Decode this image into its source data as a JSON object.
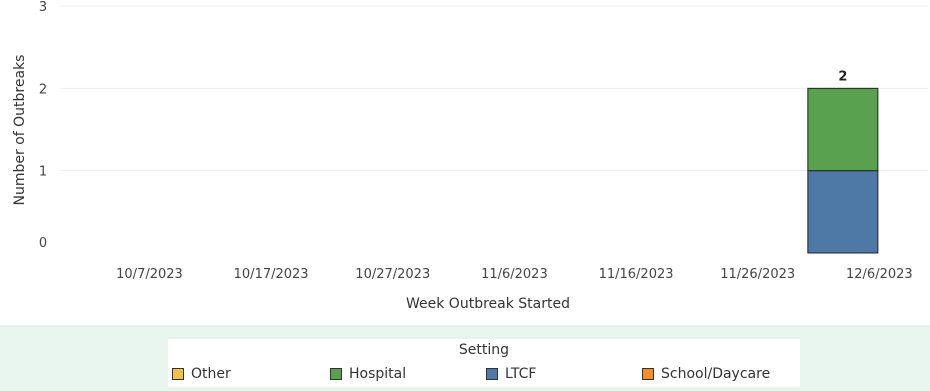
{
  "chart_data": {
    "type": "bar",
    "stacked": true,
    "xlabel": "Week Outbreak Started",
    "ylabel": "Number of Outbreaks",
    "ylim": [
      0,
      3
    ],
    "yticks": [
      "0",
      "1",
      "2",
      "3"
    ],
    "xticks": [
      "10/7/2023",
      "10/17/2023",
      "10/27/2023",
      "11/6/2023",
      "11/16/2023",
      "11/26/2023",
      "12/6/2023"
    ],
    "xtick_values": [
      "2023-10-07",
      "2023-10-17",
      "2023-10-27",
      "2023-11-06",
      "2023-11-16",
      "2023-11-26",
      "2023-12-06"
    ],
    "xlim": [
      "2023-09-28",
      "2023-12-10"
    ],
    "grid": true,
    "legend_position": "bottom",
    "bars": [
      {
        "x": "2023-12-03",
        "segments": [
          {
            "series": "LTCF",
            "value": 1
          },
          {
            "series": "Hospital",
            "value": 1
          }
        ],
        "total_label": "2"
      }
    ],
    "series": [
      {
        "name": "Other",
        "color": "#f0c24b"
      },
      {
        "name": "Hospital",
        "color": "#59a14f"
      },
      {
        "name": "LTCF",
        "color": "#4e79a7"
      },
      {
        "name": "School/Daycare",
        "color": "#f28e2b"
      }
    ]
  },
  "legend": {
    "title": "Setting",
    "items": [
      {
        "label": "Other",
        "color": "#f0c24b"
      },
      {
        "label": "Hospital",
        "color": "#59a14f"
      },
      {
        "label": "LTCF",
        "color": "#4e79a7"
      },
      {
        "label": "School/Daycare",
        "color": "#f28e2b"
      }
    ]
  }
}
